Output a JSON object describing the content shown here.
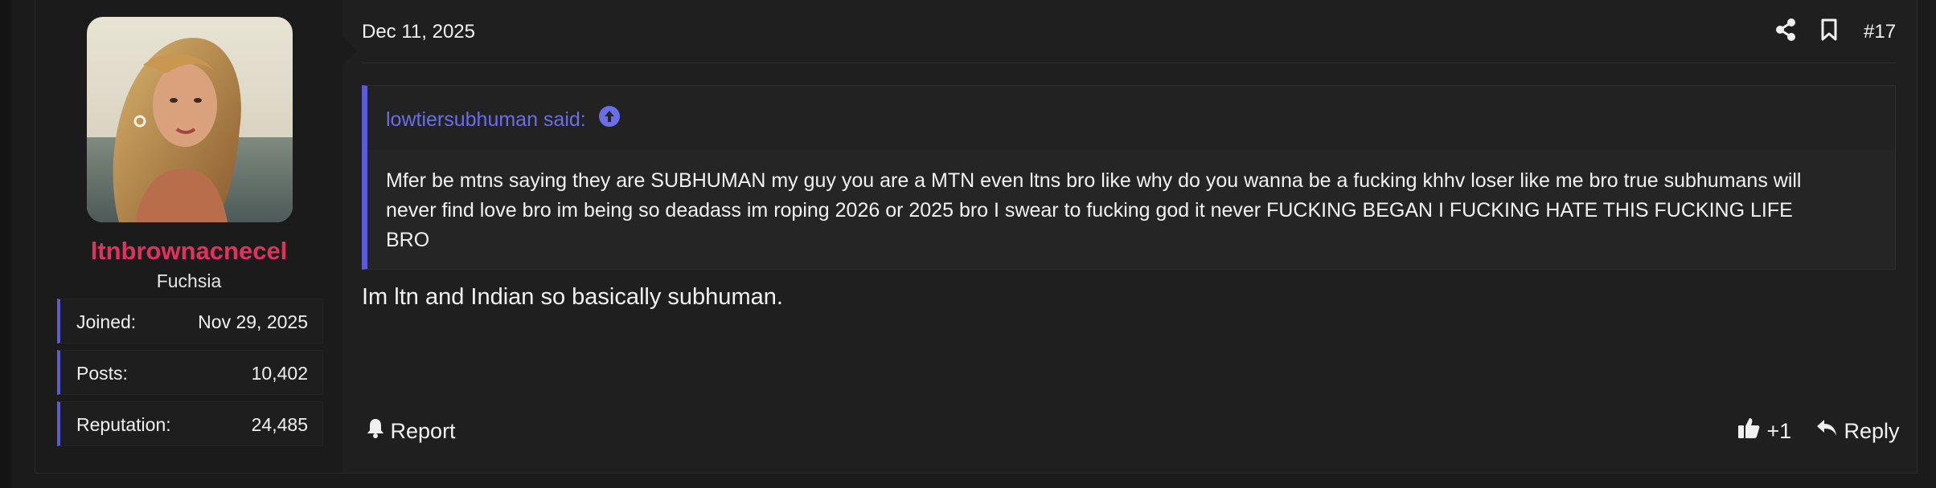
{
  "post": {
    "date": "Dec 11, 2025",
    "number": "#17",
    "message": "Im ltn and Indian so basically subhuman."
  },
  "user": {
    "name": "ltnbrownacnecel",
    "title": "Fuchsia",
    "stats": [
      {
        "label": "Joined:",
        "value": "Nov 29, 2025"
      },
      {
        "label": "Posts:",
        "value": "10,402"
      },
      {
        "label": "Reputation:",
        "value": "24,485"
      }
    ]
  },
  "quote": {
    "author": "lowtiersubhuman said:",
    "lines": [
      "Mfer be mtns saying they are SUBHUMAN my guy you are a MTN even ltns bro like why do you wanna be a fucking khhv loser like me bro true subhumans will",
      "never find love bro im being so deadass im roping 2026 or 2025 bro I swear to fucking god it never FUCKING BEGAN I FUCKING HATE THIS FUCKING LIFE",
      "BRO"
    ]
  },
  "actions": {
    "report": "Report",
    "like_count": "+1",
    "reply": "Reply"
  },
  "colors": {
    "accent": "#5b5bd6",
    "username": "#e0325f",
    "quote_author": "#6a6ee8"
  },
  "icons": [
    "share-icon",
    "bookmark-icon",
    "arrow-up-circle-icon",
    "bell-icon",
    "thumbs-up-icon",
    "reply-arrow-icon"
  ]
}
